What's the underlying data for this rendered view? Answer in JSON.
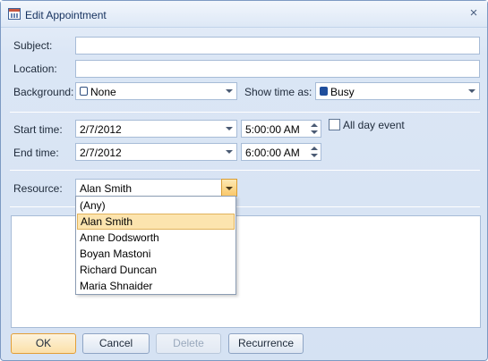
{
  "window": {
    "title": "Edit Appointment",
    "close_glyph": "×"
  },
  "form": {
    "subject": {
      "label": "Subject:",
      "value": ""
    },
    "location": {
      "label": "Location:",
      "value": ""
    },
    "background": {
      "label": "Background:",
      "value": "None",
      "color": "#ffffff"
    },
    "show_time_as": {
      "label": "Show time as:",
      "value": "Busy",
      "color": "#1f4e9c"
    },
    "start": {
      "label": "Start time:",
      "date": "2/7/2012",
      "time": "5:00:00 AM"
    },
    "end": {
      "label": "End time:",
      "date": "2/7/2012",
      "time": "6:00:00 AM"
    },
    "all_day": {
      "label": "All day event",
      "checked": false
    },
    "resource": {
      "label": "Resource:",
      "value": "Alan Smith",
      "options": [
        "(Any)",
        "Alan Smith",
        "Anne Dodsworth",
        "Boyan Mastoni",
        "Richard Duncan",
        "Maria Shnaider"
      ],
      "selected_index": 1
    }
  },
  "buttons": {
    "ok": "OK",
    "cancel": "Cancel",
    "delete": "Delete",
    "recurrence": "Recurrence"
  },
  "colors": {
    "accent_border": "#e39f37",
    "highlight": "#fce4ae"
  }
}
